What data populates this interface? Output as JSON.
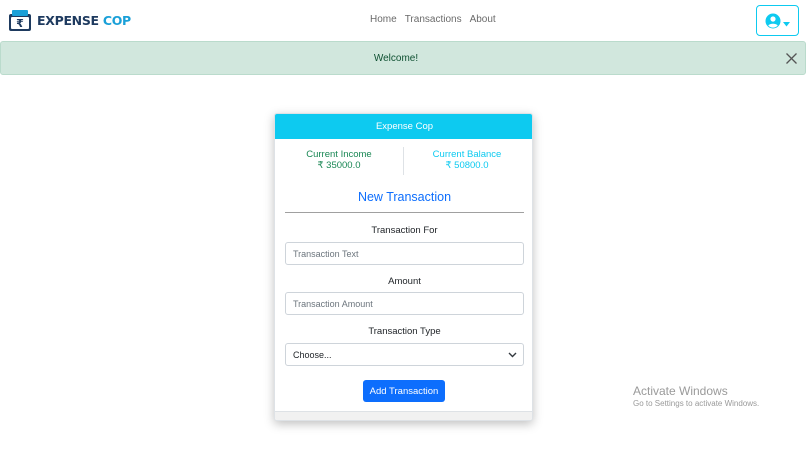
{
  "navbar": {
    "brand": {
      "word1": "EXPENSE",
      "word2": "COP",
      "logo_icon": "rupee-wallet-icon"
    },
    "links": [
      {
        "label": "Home"
      },
      {
        "label": "Transactions"
      },
      {
        "label": "About"
      }
    ],
    "user_menu": {
      "icon": "user-circle-icon",
      "caret_icon": "caret-down-icon"
    }
  },
  "alert": {
    "message": "Welcome!",
    "close_icon": "close-icon"
  },
  "card": {
    "header": "Expense Cop",
    "income": {
      "label": "Current Income",
      "value": "₹ 35000.0"
    },
    "balance": {
      "label": "Current Balance",
      "value": "₹ 50800.0"
    },
    "form_title": "New Transaction",
    "fields": {
      "text": {
        "label": "Transaction For",
        "placeholder": "Transaction Text",
        "value": ""
      },
      "amount": {
        "label": "Amount",
        "placeholder": "Transaction Amount",
        "value": ""
      },
      "type": {
        "label": "Transaction Type",
        "selected": "Choose...",
        "chevron_icon": "chevron-down-icon"
      }
    },
    "submit_label": "Add Transaction"
  },
  "watermark": {
    "title": "Activate Windows",
    "subtitle": "Go to Settings to activate Windows."
  },
  "colors": {
    "info": "#0dcaf0",
    "primary": "#0d6efd",
    "success": "#198754",
    "alert_bg": "#d1e7dd",
    "brand_dark": "#1e3a5f"
  }
}
